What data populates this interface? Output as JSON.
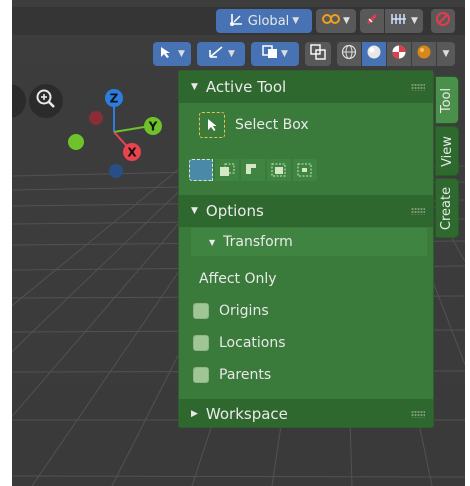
{
  "header": {
    "orientation": {
      "label": "Global"
    },
    "icons": [
      "transform-orientation-icon",
      "pivot-icon",
      "snap-icon",
      "proportional-edit-icon",
      "overlay-off-icon"
    ]
  },
  "header2": {
    "icons": [
      "view-selector-icon",
      "gizmo-icon",
      "overlay-icon",
      "xray-icon",
      "wireframe-shading-icon",
      "solid-shading-icon",
      "material-shading-icon",
      "rendered-shading-icon"
    ]
  },
  "gizmo": {
    "z": "Z",
    "y": "Y",
    "x": "X"
  },
  "npanel": {
    "active_tool": {
      "title": "Active Tool",
      "tool_name": "Select Box"
    },
    "options": {
      "title": "Options",
      "transform": {
        "title": "Transform",
        "affect_only_label": "Affect Only",
        "checkboxes": [
          {
            "label": "Origins",
            "checked": false
          },
          {
            "label": "Locations",
            "checked": false
          },
          {
            "label": "Parents",
            "checked": false
          }
        ]
      }
    },
    "workspace": {
      "title": "Workspace"
    }
  },
  "tabs": [
    {
      "label": "Tool",
      "active": true
    },
    {
      "label": "View",
      "active": false
    },
    {
      "label": "Create",
      "active": false
    }
  ],
  "colors": {
    "panel_green": "#3a7a3a",
    "axis_x": "#e8434f",
    "axis_y": "#6ec32a",
    "axis_z": "#2b7ee0"
  }
}
